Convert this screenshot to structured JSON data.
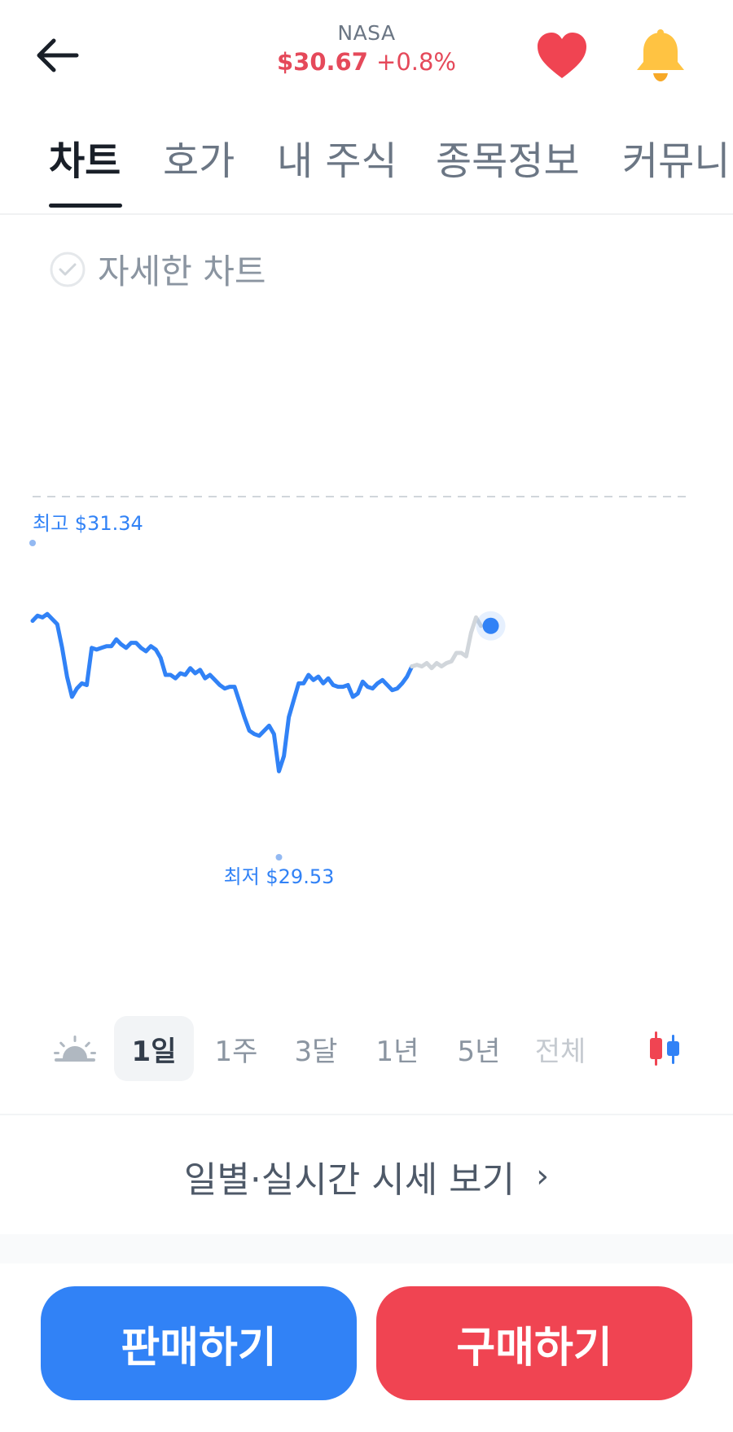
{
  "header": {
    "ticker": "NASA",
    "price": "$30.67",
    "change": "+0.8%",
    "colors": {
      "price": "#e5495a",
      "heart": "#f04452",
      "bell": "#ffc342"
    },
    "icons": {
      "back": "arrow-left-icon",
      "favorite": "heart-icon",
      "alert": "bell-icon"
    }
  },
  "tabs": [
    {
      "label": "차트",
      "active": true
    },
    {
      "label": "호가",
      "active": false
    },
    {
      "label": "내 주식",
      "active": false
    },
    {
      "label": "종목정보",
      "active": false
    },
    {
      "label": "커뮤니티",
      "active": false
    }
  ],
  "detail_toggle": {
    "label": "자세한 차트",
    "checked": false
  },
  "chart_data": {
    "type": "line",
    "period": "1일",
    "high_label": "최고 $31.34",
    "low_label": "최저 $29.53",
    "high": 31.34,
    "low": 29.53,
    "reference_line": "dashed",
    "colors": {
      "line": "#3182f6",
      "extended": "#d1d6db",
      "labels": "#3182f6"
    },
    "series": [
      {
        "values": [
          30.88,
          30.91,
          30.9,
          30.92,
          30.89,
          30.86,
          30.72,
          30.55,
          30.43,
          30.48,
          30.51,
          30.5,
          30.72,
          30.71,
          30.72,
          30.73,
          30.73,
          30.77,
          30.74,
          30.72,
          30.75,
          30.75,
          30.72,
          30.7,
          30.73,
          30.71,
          30.66,
          30.56,
          30.56,
          30.54,
          30.57,
          30.56,
          30.6,
          30.57,
          30.59,
          30.54,
          30.56,
          30.53,
          30.5,
          30.48,
          30.49,
          30.49,
          30.4,
          30.31,
          30.23,
          30.21,
          30.2,
          30.23,
          30.26,
          30.21,
          29.99,
          30.08,
          30.31,
          30.41,
          30.51,
          30.51,
          30.56,
          30.53,
          30.55,
          30.51,
          30.54,
          30.5,
          30.49,
          30.49,
          30.5,
          30.43,
          30.45,
          30.52,
          30.49,
          30.48,
          30.51,
          30.53,
          30.5,
          30.47,
          30.48,
          30.51,
          30.55,
          30.61
        ]
      },
      {
        "values": [
          30.61,
          30.62,
          30.61,
          30.63,
          30.6,
          30.63,
          30.61,
          30.63,
          30.64,
          30.69,
          30.69,
          30.67,
          30.81,
          30.9,
          30.85
        ]
      }
    ],
    "current_value": 30.85
  },
  "periods": [
    {
      "label": "",
      "icon": "sunrise-icon"
    },
    {
      "label": "1일",
      "active": true
    },
    {
      "label": "1주"
    },
    {
      "label": "3달"
    },
    {
      "label": "1년"
    },
    {
      "label": "5년"
    },
    {
      "label": "전체",
      "muted": true
    },
    {
      "label": "",
      "icon": "candlestick-icon"
    }
  ],
  "daily_link": {
    "label": "일별·실시간 시세 보기",
    "chevron": "›"
  },
  "actions": {
    "sell": "판매하기",
    "buy": "구매하기",
    "sell_color": "#3182f6",
    "buy_color": "#f04452"
  }
}
